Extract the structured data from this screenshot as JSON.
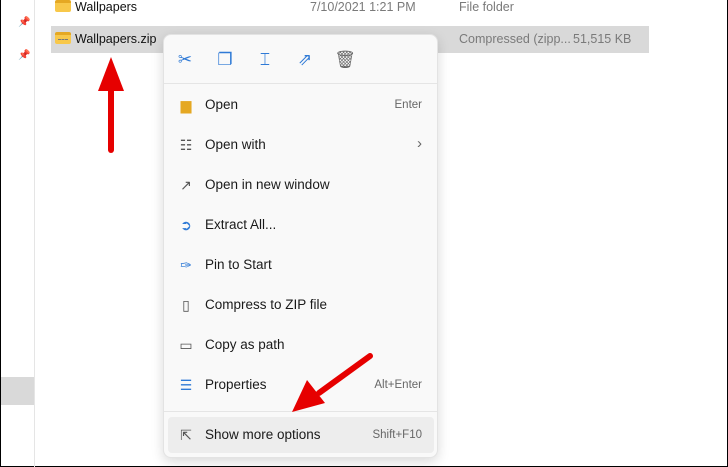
{
  "files": [
    {
      "name": "Wallpapers",
      "date": "7/10/2021 1:21 PM",
      "type": "File folder",
      "size": ""
    },
    {
      "name": "Wallpapers.zip",
      "date": "",
      "type": "Compressed (zipp...",
      "size": "51,515 KB"
    }
  ],
  "toolbar": [
    "cut-icon",
    "copy-icon",
    "rename-icon",
    "share-icon",
    "delete-icon"
  ],
  "menu": [
    {
      "label": "Open",
      "shortcut": "Enter",
      "icon": "folder-open-icon"
    },
    {
      "label": "Open with",
      "shortcut": "›",
      "icon": "open-with-icon"
    },
    {
      "label": "Open in new window",
      "shortcut": "",
      "icon": "new-window-icon"
    },
    {
      "label": "Extract All...",
      "shortcut": "",
      "icon": "extract-icon"
    },
    {
      "label": "Pin to Start",
      "shortcut": "",
      "icon": "pin-icon"
    },
    {
      "label": "Compress to ZIP file",
      "shortcut": "",
      "icon": "zip-icon"
    },
    {
      "label": "Copy as path",
      "shortcut": "",
      "icon": "path-icon"
    },
    {
      "label": "Properties",
      "shortcut": "Alt+Enter",
      "icon": "properties-icon"
    },
    {
      "label": "Show more options",
      "shortcut": "Shift+F10",
      "icon": "more-options-icon"
    }
  ],
  "colors": {
    "accent": "#2f7ad6",
    "arrow": "#e60000"
  }
}
